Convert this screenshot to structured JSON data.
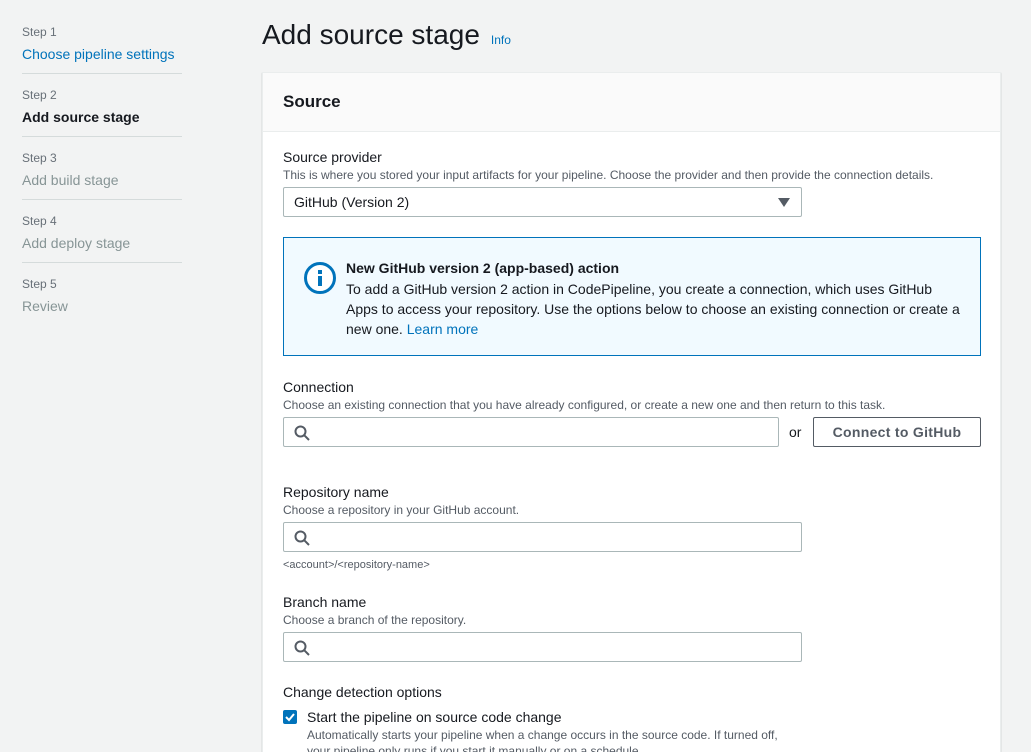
{
  "steps": [
    {
      "num": "Step 1",
      "label": "Choose pipeline settings"
    },
    {
      "num": "Step 2",
      "label": "Add source stage"
    },
    {
      "num": "Step 3",
      "label": "Add build stage"
    },
    {
      "num": "Step 4",
      "label": "Add deploy stage"
    },
    {
      "num": "Step 5",
      "label": "Review"
    }
  ],
  "page": {
    "title": "Add source stage",
    "info": "Info"
  },
  "source": {
    "header": "Source",
    "provider_label": "Source provider",
    "provider_desc": "This is where you stored your input artifacts for your pipeline. Choose the provider and then provide the connection details.",
    "provider_value": "GitHub (Version 2)"
  },
  "alert": {
    "title": "New GitHub version 2 (app-based) action",
    "body": "To add a GitHub version 2 action in CodePipeline, you create a connection, which uses GitHub Apps to access your repository. Use the options below to choose an existing connection or create a new one.",
    "link": "Learn more"
  },
  "connection": {
    "label": "Connection",
    "desc": "Choose an existing connection that you have already configured, or create a new one and then return to this task.",
    "or": "or",
    "button": "Connect to GitHub"
  },
  "repository": {
    "label": "Repository name",
    "desc": "Choose a repository in your GitHub account.",
    "constraint": "<account>/<repository-name>"
  },
  "branch": {
    "label": "Branch name",
    "desc": "Choose a branch of the repository."
  },
  "change_detection": {
    "label": "Change detection options",
    "checkbox_label": "Start the pipeline on source code change",
    "checkbox_checked": true,
    "checkbox_desc": "Automatically starts your pipeline when a change occurs in the source code. If turned off, your pipeline only runs if you start it manually or on a schedule."
  },
  "colors": {
    "link": "#0073bb",
    "alert_bg": "#f1faff",
    "background": "#f2f3f3"
  }
}
